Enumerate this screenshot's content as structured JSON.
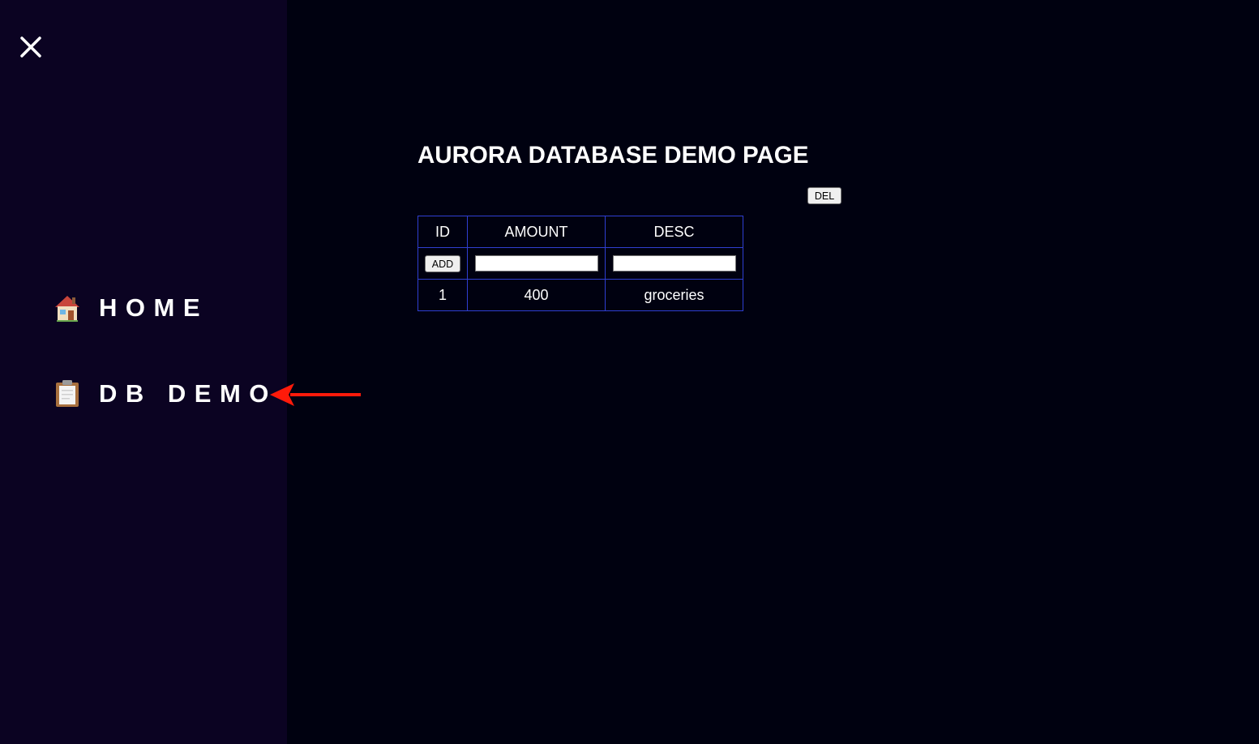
{
  "sidebar": {
    "close_icon": "close-icon",
    "items": [
      {
        "label": "HOME",
        "icon": "house-icon"
      },
      {
        "label": "DB DEMO",
        "icon": "clipboard-icon"
      }
    ]
  },
  "annotation": {
    "icon": "red-arrow-icon",
    "color": "#ff1a0a"
  },
  "main": {
    "title": "AURORA DATABASE DEMO PAGE",
    "del_label": "DEL",
    "table": {
      "headers": [
        "ID",
        "AMOUNT",
        "DESC"
      ],
      "add_label": "ADD",
      "amount_value": "",
      "desc_value": "",
      "rows": [
        {
          "id": "1",
          "amount": "400",
          "desc": "groceries"
        }
      ]
    }
  },
  "colors": {
    "page_background": "#000110",
    "sidebar_background": "#0b0322",
    "table_border": "#2f3fd1",
    "text": "#ffffff"
  }
}
